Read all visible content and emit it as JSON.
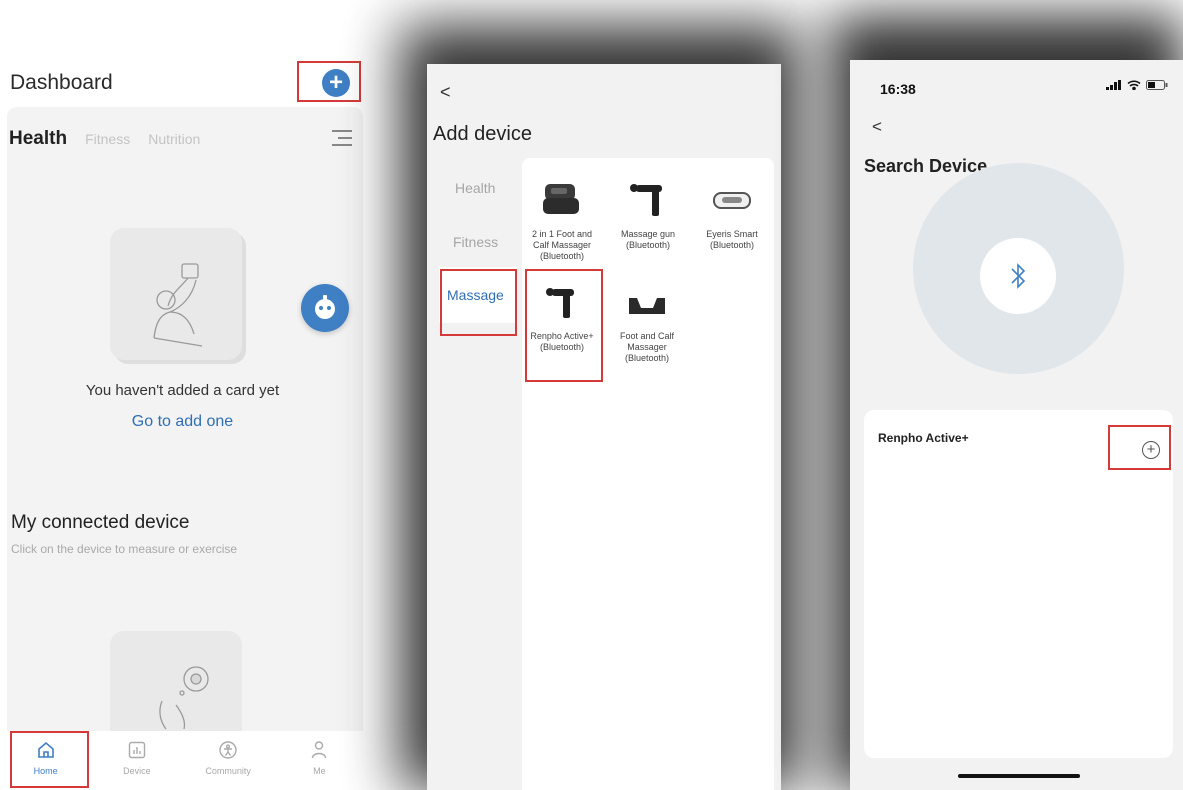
{
  "dashboard": {
    "title": "Dashboard",
    "add_icon": "plus-circle-icon",
    "tabs": {
      "health": "Health",
      "fitness": "Fitness",
      "nutrition": "Nutrition"
    },
    "empty_text": "You haven't added a card yet",
    "add_link": "Go to add one",
    "section_title": "My connected device",
    "section_subtitle": "Click on the device to measure or exercise",
    "nav": [
      {
        "label": "Home",
        "icon": "home-icon",
        "active": true
      },
      {
        "label": "Device",
        "icon": "bar-chart-icon",
        "active": false
      },
      {
        "label": "Community",
        "icon": "person-icon",
        "active": false
      },
      {
        "label": "Me",
        "icon": "user-icon",
        "active": false
      }
    ]
  },
  "add_device": {
    "back": "<",
    "title": "Add device",
    "categories": {
      "health": "Health",
      "fitness": "Fitness",
      "massage": "Massage"
    },
    "devices": [
      {
        "name": "2 in 1 Foot and Calf Massager",
        "conn": "(Bluetooth)"
      },
      {
        "name": "Massage gun",
        "conn": "(Bluetooth)"
      },
      {
        "name": "Eyeris Smart",
        "conn": "(Bluetooth)"
      },
      {
        "name": "Renpho Active+",
        "conn": "(Bluetooth)"
      },
      {
        "name": "Foot and Calf Massager",
        "conn": "(Bluetooth)"
      }
    ]
  },
  "search_device": {
    "time": "16:38",
    "back": "<",
    "title": "Search Device",
    "device_name": "Renpho Active+",
    "add_symbol": "+"
  },
  "colors": {
    "accent": "#3f7fc4",
    "highlight": "#d43a3a"
  }
}
